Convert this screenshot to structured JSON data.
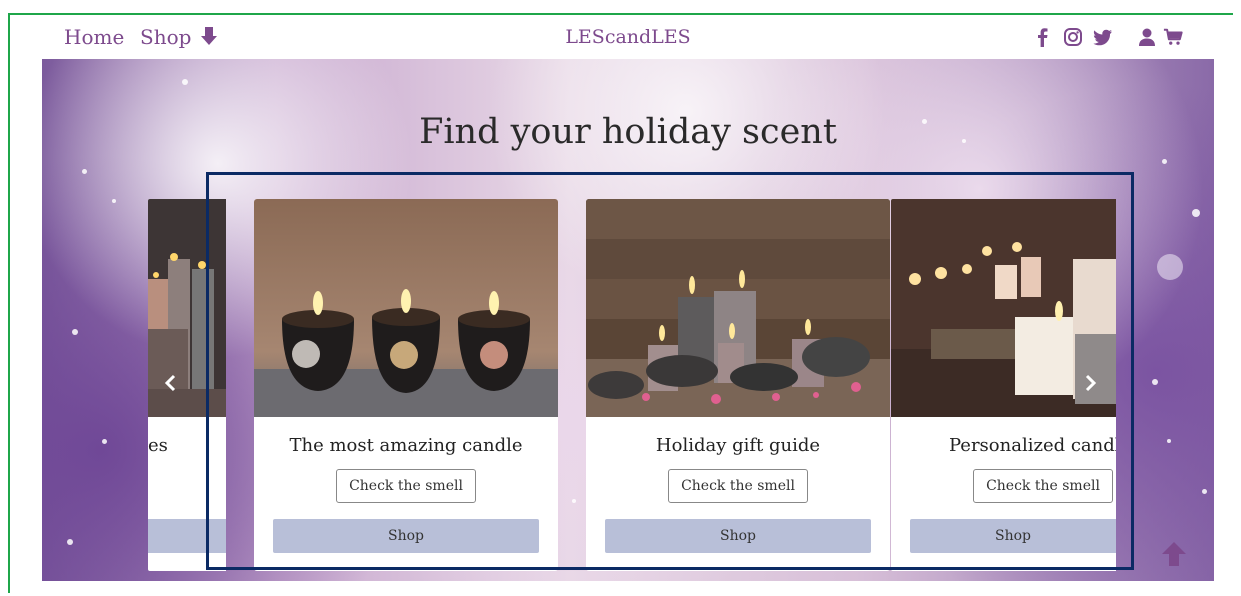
{
  "nav": {
    "home": "Home",
    "shop": "Shop",
    "brand": "LEScandLES",
    "icons": [
      "facebook-icon",
      "instagram-icon",
      "twitter-icon",
      "user-icon",
      "cart-icon"
    ]
  },
  "hero": {
    "title": "Find your holiday scent"
  },
  "cards": [
    {
      "title": "es",
      "check": "",
      "shop": ""
    },
    {
      "title": "The most amazing candle",
      "check": "Check the smell",
      "shop": "Shop"
    },
    {
      "title": "Holiday gift guide",
      "check": "Check the smell",
      "shop": "Shop"
    },
    {
      "title": "Personalized candl",
      "check": "Check the smell",
      "shop": "Shop"
    }
  ],
  "colors": {
    "accent": "#7d4a8d",
    "shop_button": "#b8bfd8",
    "outline": "#0b2a64",
    "frame": "#1fa64a"
  }
}
